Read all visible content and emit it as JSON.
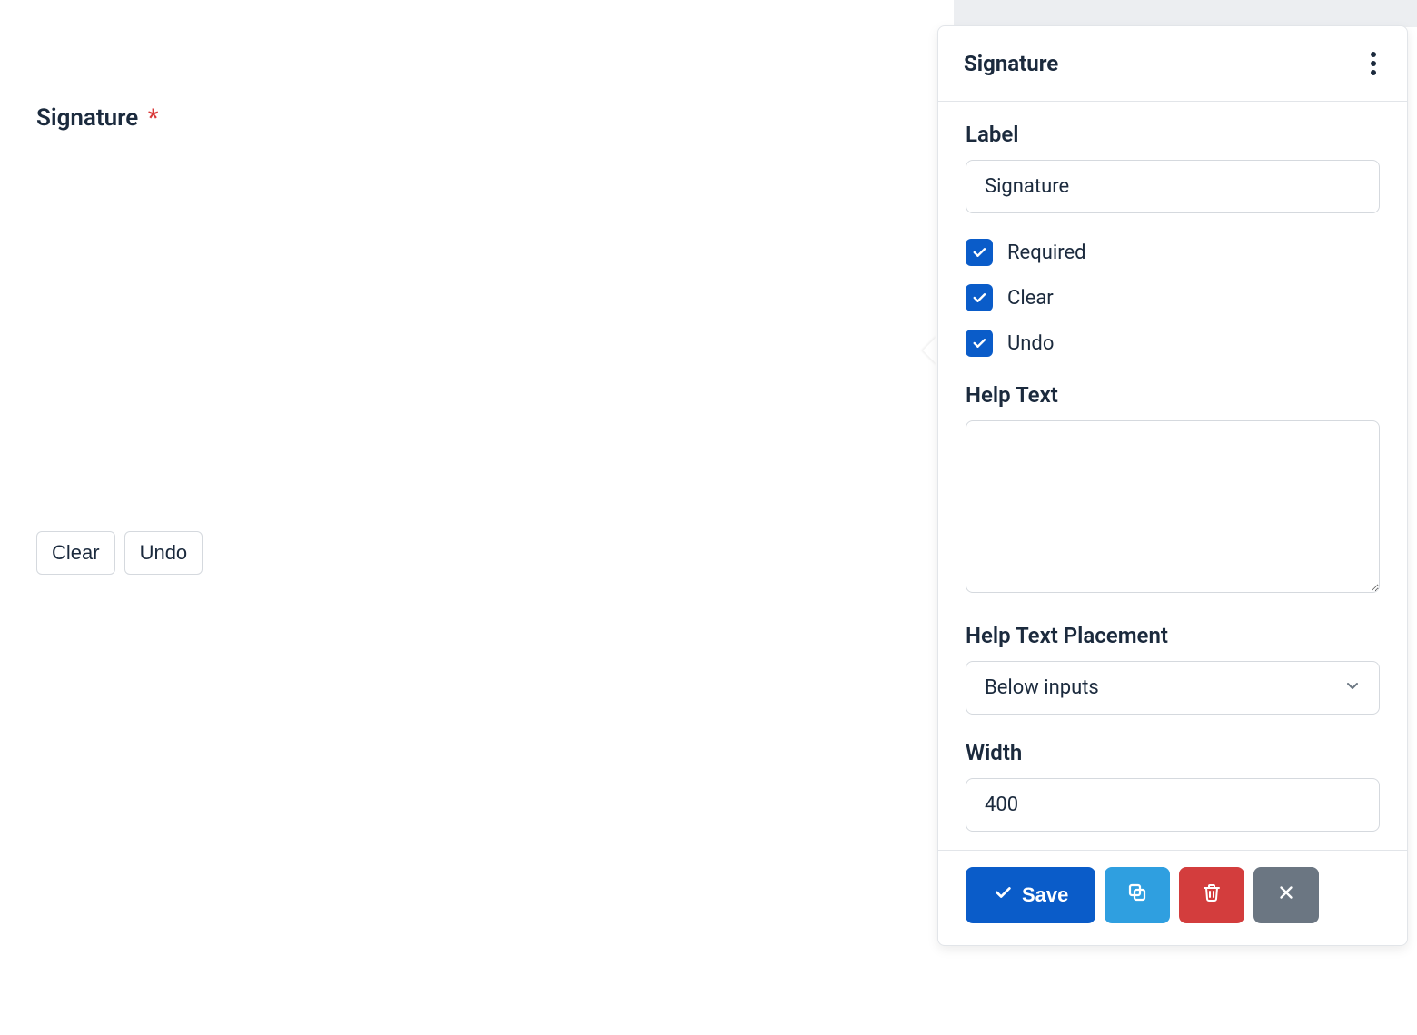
{
  "preview": {
    "label": "Signature",
    "required_mark": "*",
    "clear_btn": "Clear",
    "undo_btn": "Undo"
  },
  "panel": {
    "title": "Signature",
    "label_field": {
      "label": "Label",
      "value": "Signature"
    },
    "checkboxes": {
      "required": "Required",
      "clear": "Clear",
      "undo": "Undo"
    },
    "help_text": {
      "label": "Help Text",
      "value": ""
    },
    "placement": {
      "label": "Help Text Placement",
      "value": "Below inputs"
    },
    "width": {
      "label": "Width",
      "value": "400"
    },
    "footer": {
      "save": "Save"
    }
  }
}
